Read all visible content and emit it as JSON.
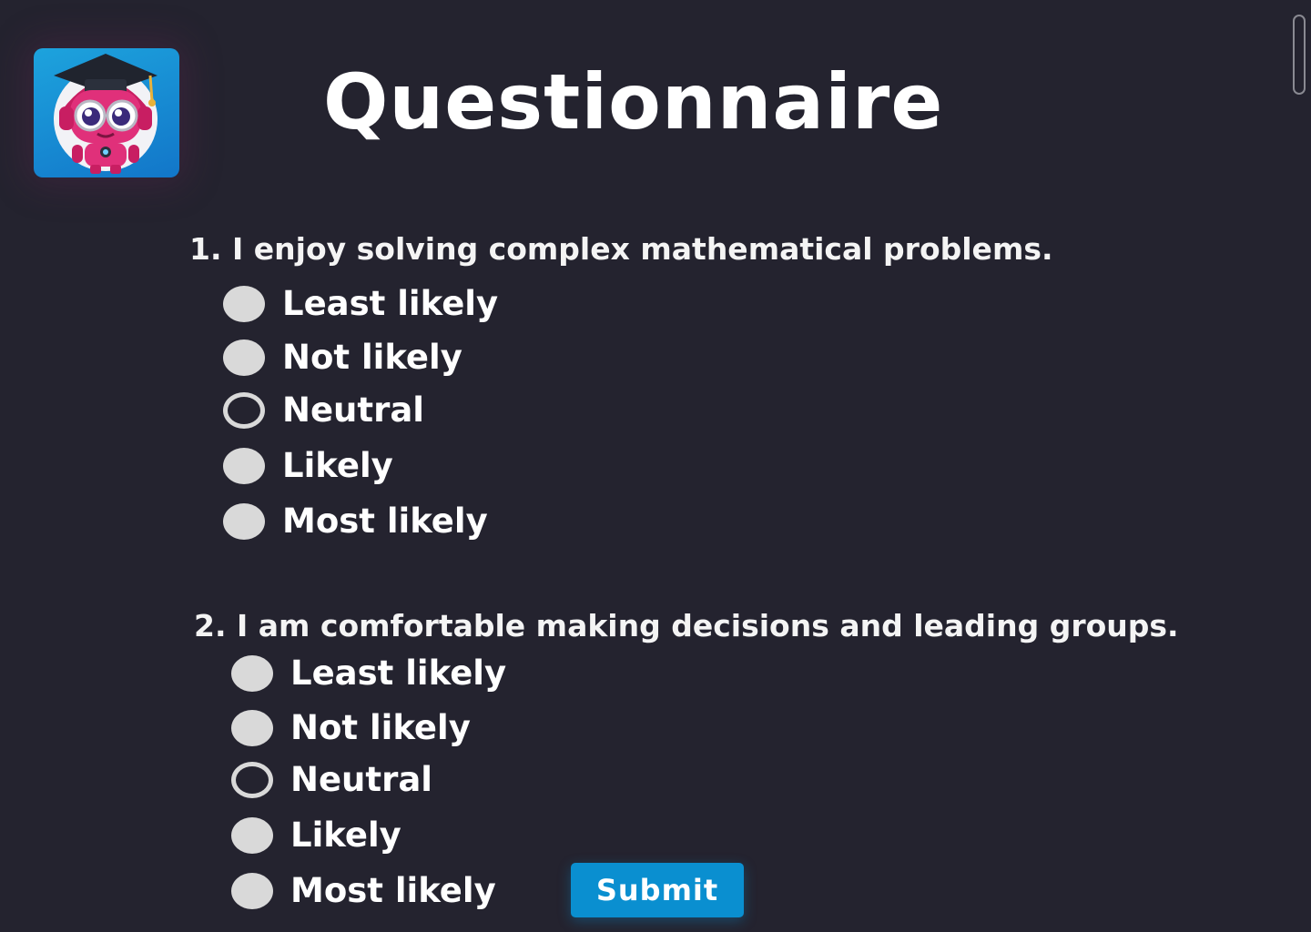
{
  "page": {
    "title": "Questionnaire"
  },
  "logo": {
    "icon": "robot-graduate-icon"
  },
  "questions": [
    {
      "number": "1.",
      "text": "I enjoy solving complex mathematical problems.",
      "options": [
        "Least likely",
        "Not likely",
        "Neutral",
        "Likely",
        "Most likely"
      ],
      "selected": "Neutral"
    },
    {
      "number": "2.",
      "text": "I am comfortable making decisions and leading groups.",
      "options": [
        "Least likely",
        "Not likely",
        "Neutral",
        "Likely",
        "Most likely"
      ],
      "selected": "Neutral"
    }
  ],
  "submit": {
    "label": "Submit"
  },
  "colors": {
    "background": "#24232f",
    "radio": "#d9d9d9",
    "accent": "#0a8fd0",
    "logo_background": "#1da3dd",
    "robot_pink": "#e0307a"
  }
}
